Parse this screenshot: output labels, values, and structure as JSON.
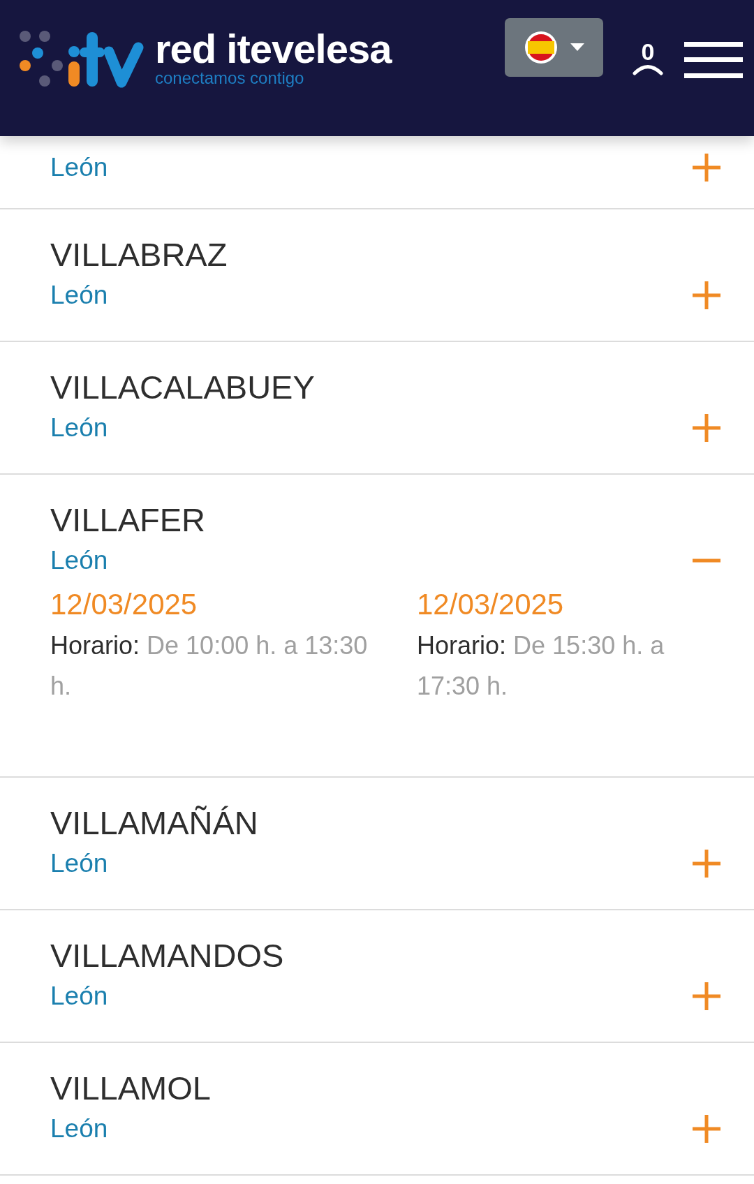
{
  "header": {
    "brand": "red itevelesa",
    "tagline": "conectamos contigo",
    "user_count": "0"
  },
  "stations": [
    {
      "region": "León",
      "expanded": false
    },
    {
      "name": "VILLABRAZ",
      "region": "León",
      "expanded": false
    },
    {
      "name": "VILLACALABUEY",
      "region": "León",
      "expanded": false
    },
    {
      "name": "VILLAFER",
      "region": "León",
      "expanded": true,
      "schedules": [
        {
          "date": "12/03/2025",
          "label": "Horario:",
          "hours": "De 10:00 h. a 13:30 h."
        },
        {
          "date": "12/03/2025",
          "label": "Horario:",
          "hours": "De 15:30 h. a 17:30 h."
        }
      ]
    },
    {
      "name": "VILLAMAÑÁN",
      "region": "León",
      "expanded": false
    },
    {
      "name": "VILLAMANDOS",
      "region": "León",
      "expanded": false
    },
    {
      "name": "VILLAMOL",
      "region": "León",
      "expanded": false
    }
  ]
}
